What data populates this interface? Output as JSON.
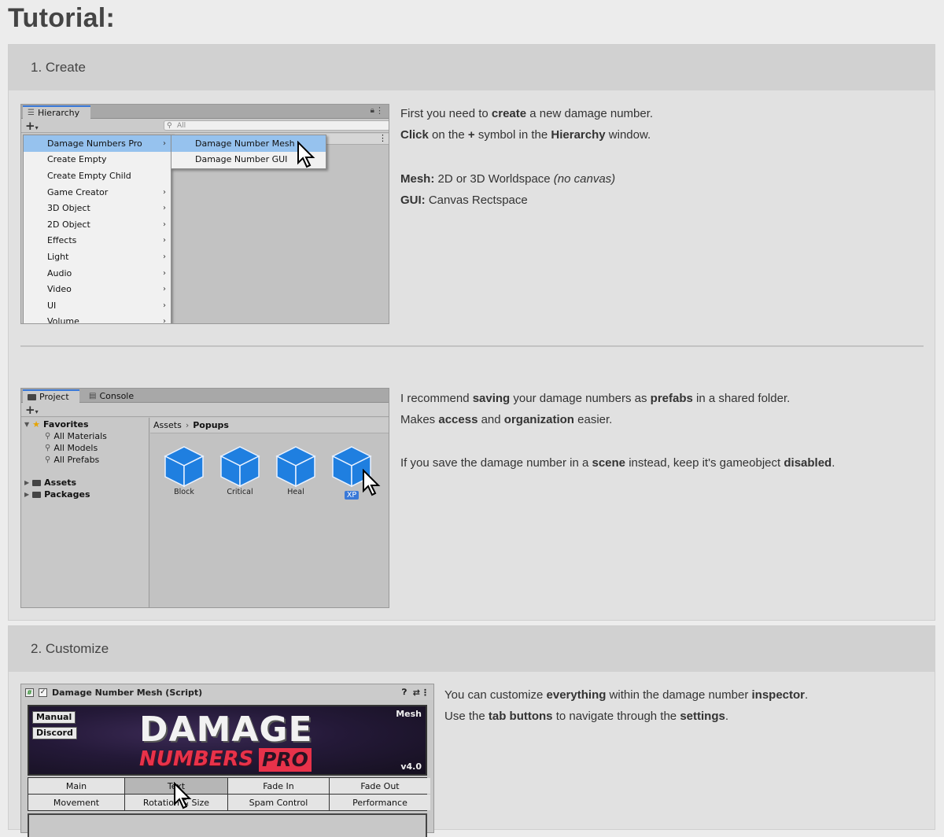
{
  "page": {
    "title": "Tutorial:"
  },
  "sections": [
    {
      "header": "1. Create",
      "step1": {
        "hierarchy": {
          "tab_label": "Hierarchy",
          "search_placeholder": "All",
          "menu_items": [
            {
              "label": "Damage Numbers Pro",
              "arrow": "›",
              "highlight": true
            },
            {
              "label": "Create Empty",
              "arrow": ""
            },
            {
              "label": "Create Empty Child",
              "arrow": ""
            },
            {
              "label": "Game Creator",
              "arrow": "›"
            },
            {
              "label": "3D Object",
              "arrow": "›"
            },
            {
              "label": "2D Object",
              "arrow": "›"
            },
            {
              "label": "Effects",
              "arrow": "›"
            },
            {
              "label": "Light",
              "arrow": "›"
            },
            {
              "label": "Audio",
              "arrow": "›"
            },
            {
              "label": "Video",
              "arrow": "›"
            },
            {
              "label": "UI",
              "arrow": "›"
            },
            {
              "label": "Volume",
              "arrow": "›"
            }
          ],
          "submenu_items": [
            {
              "label": "Damage Number Mesh",
              "highlight": true
            },
            {
              "label": "Damage Number GUI"
            }
          ]
        },
        "description": {
          "line1": {
            "a": "First you need to ",
            "b": "create",
            "c": " a new damage number."
          },
          "line2": {
            "a": "Click",
            "b": " on the ",
            "c": "+",
            "d": " symbol in the ",
            "e": "Hierarchy",
            "f": " window."
          },
          "line3": {
            "a": "Mesh:",
            "b": " 2D or 3D Worldspace ",
            "c": "(no canvas)"
          },
          "line4": {
            "a": "GUI:",
            "b": " Canvas Rectspace"
          }
        }
      },
      "step2": {
        "project": {
          "tab_project": "Project",
          "tab_console": "Console",
          "favorites_label": "Favorites",
          "favorites": [
            "All Materials",
            "All Models",
            "All Prefabs"
          ],
          "assets_label": "Assets",
          "packages_label": "Packages",
          "breadcrumb": {
            "root": "Assets",
            "sep": "›",
            "current": "Popups"
          },
          "prefabs": [
            "Block",
            "Critical",
            "Heal",
            "XP"
          ],
          "cube_color": "#1f7fe0"
        },
        "description": {
          "line1": {
            "a": "I recommend ",
            "b": "saving",
            "c": " your damage numbers as ",
            "d": "prefabs",
            "e": " in a shared folder."
          },
          "line2": {
            "a": "Makes ",
            "b": "access",
            "c": " and ",
            "d": "organization",
            "e": " easier."
          },
          "line3": {
            "a": "If you save the damage number in a ",
            "b": "scene",
            "c": " instead, keep it's gameobject ",
            "d": "disabled",
            "e": "."
          }
        }
      }
    },
    {
      "header": "2. Customize",
      "inspector": {
        "component_title": "Damage Number Mesh (Script)",
        "banner": {
          "manual_button": "Manual",
          "discord_button": "Discord",
          "title_top": "DAMAGE",
          "title_bottom": "NUMBERS",
          "title_pro": "PRO",
          "corner_label": "Mesh",
          "version": "v4.0"
        },
        "tabs_row1": [
          "Main",
          "Text",
          "Fade In",
          "Fade Out"
        ],
        "tabs_row2": [
          "Movement",
          "Rotation & Size",
          "Spam Control",
          "Performance"
        ]
      },
      "description": {
        "line1": {
          "a": "You can customize ",
          "b": "everything",
          "c": " within the damage number ",
          "d": "inspector",
          "e": "."
        },
        "line2": {
          "a": "Use the ",
          "b": "tab buttons",
          "c": " to navigate through the ",
          "d": "settings",
          "e": "."
        }
      }
    }
  ]
}
